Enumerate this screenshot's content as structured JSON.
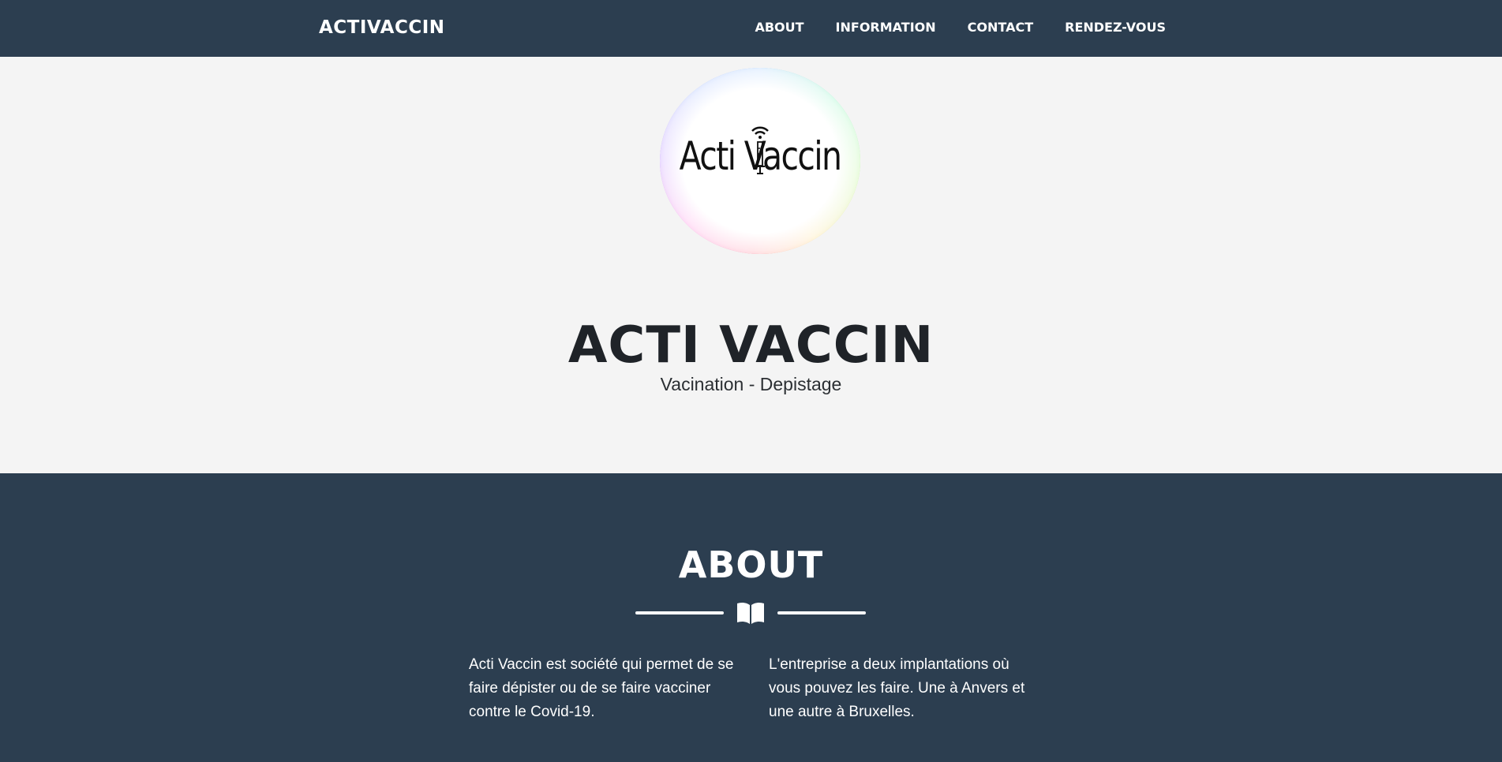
{
  "navbar": {
    "brand": "ACTIVACCIN",
    "links": [
      "ABOUT",
      "INFORMATION",
      "CONTACT",
      "RENDEZ-VOUS"
    ]
  },
  "masthead": {
    "logo_text": "Acti Vaccin",
    "title": "ACTI VACCIN",
    "subtitle": "Vacination - Depistage"
  },
  "about": {
    "title": "ABOUT",
    "divider_icon": "book-open-icon",
    "column_left": "Acti Vaccin est société qui permet de se faire dépister ou de se faire vacciner contre le Covid-19.",
    "column_right": "L'entreprise a deux implantations où vous pouvez les faire. Une à Anvers et une autre à Bruxelles."
  },
  "colors": {
    "nav_bg": "#2c3e50",
    "masthead_bg": "#f4f4f4",
    "about_bg": "#2c3e50",
    "text_light": "#ffffff",
    "text_dark": "#1f2328"
  }
}
